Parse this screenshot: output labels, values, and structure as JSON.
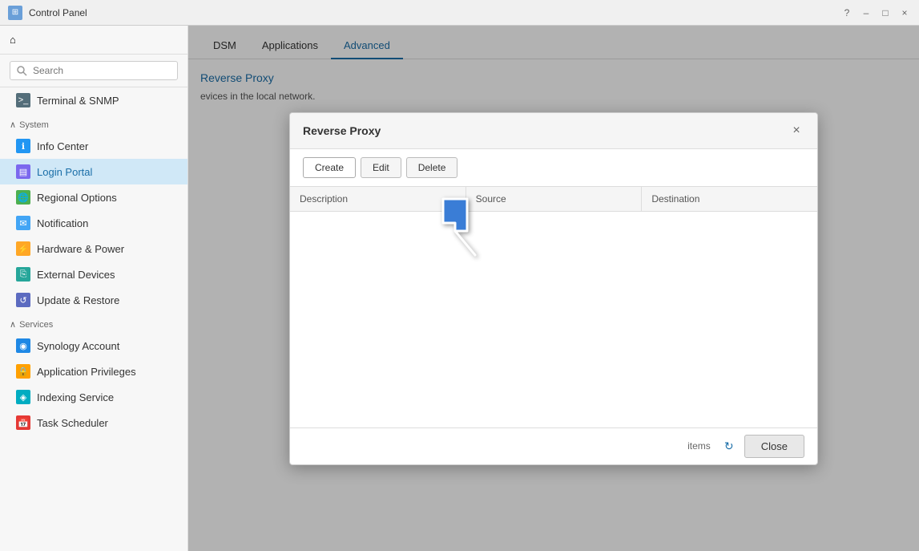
{
  "titlebar": {
    "icon": "⊞",
    "title": "Control Panel",
    "help_label": "?",
    "minimize_label": "–",
    "maximize_label": "□",
    "close_label": "×"
  },
  "sidebar": {
    "search_placeholder": "Search",
    "home_icon": "⌂",
    "sections": [
      {
        "id": "system",
        "label": "System",
        "arrow": "∧"
      },
      {
        "id": "services",
        "label": "Services",
        "arrow": "∧"
      }
    ],
    "items": [
      {
        "id": "terminal",
        "label": "Terminal & SNMP",
        "icon": ">_",
        "icon_class": "icon-terminal",
        "section": "top"
      },
      {
        "id": "info-center",
        "label": "Info Center",
        "icon": "ℹ",
        "icon_class": "icon-info",
        "section": "system"
      },
      {
        "id": "login-portal",
        "label": "Login Portal",
        "icon": "▤",
        "icon_class": "icon-login",
        "section": "system",
        "active": true
      },
      {
        "id": "regional",
        "label": "Regional Options",
        "icon": "🌐",
        "icon_class": "icon-regional",
        "section": "system"
      },
      {
        "id": "notification",
        "label": "Notification",
        "icon": "✉",
        "icon_class": "icon-notification",
        "section": "system"
      },
      {
        "id": "hardware",
        "label": "Hardware & Power",
        "icon": "⚡",
        "icon_class": "icon-hardware",
        "section": "system"
      },
      {
        "id": "external",
        "label": "External Devices",
        "icon": "⎘",
        "icon_class": "icon-external",
        "section": "system"
      },
      {
        "id": "update",
        "label": "Update & Restore",
        "icon": "↺",
        "icon_class": "icon-update",
        "section": "system"
      },
      {
        "id": "synology",
        "label": "Synology Account",
        "icon": "◉",
        "icon_class": "icon-synology",
        "section": "services"
      },
      {
        "id": "apppriv",
        "label": "Application Privileges",
        "icon": "🔒",
        "icon_class": "icon-apppriv",
        "section": "services"
      },
      {
        "id": "indexing",
        "label": "Indexing Service",
        "icon": "◈",
        "icon_class": "icon-indexing",
        "section": "services"
      },
      {
        "id": "task",
        "label": "Task Scheduler",
        "icon": "📅",
        "icon_class": "icon-task",
        "section": "services"
      }
    ]
  },
  "content": {
    "tabs": [
      {
        "id": "dsm",
        "label": "DSM",
        "active": false
      },
      {
        "id": "applications",
        "label": "Applications",
        "active": false
      },
      {
        "id": "advanced",
        "label": "Advanced",
        "active": true
      }
    ],
    "title": "Reverse Proxy",
    "description": "evices in the local network."
  },
  "modal": {
    "title": "Reverse Proxy",
    "close_label": "×",
    "buttons": {
      "create": "Create",
      "edit": "Edit",
      "delete": "Delete"
    },
    "table": {
      "columns": [
        "Description",
        "Source",
        "Destination"
      ]
    },
    "footer": {
      "items_label": "items",
      "close_label": "Close"
    }
  }
}
